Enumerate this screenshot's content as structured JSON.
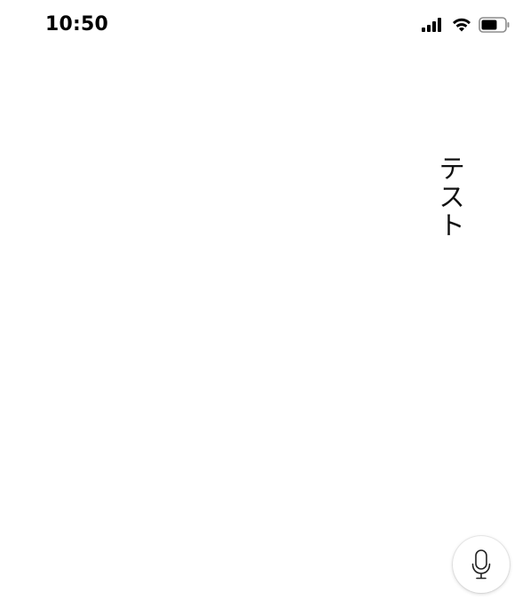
{
  "status_bar": {
    "time": "10:50",
    "icons": [
      "cellular-signal-icon",
      "wifi-icon",
      "battery-icon"
    ]
  },
  "content": {
    "vertical_text": "テスト"
  },
  "mic_button": {
    "icon": "microphone-icon"
  },
  "colors": {
    "background": "#ffffff",
    "text": "#111111",
    "icon": "#000000"
  }
}
